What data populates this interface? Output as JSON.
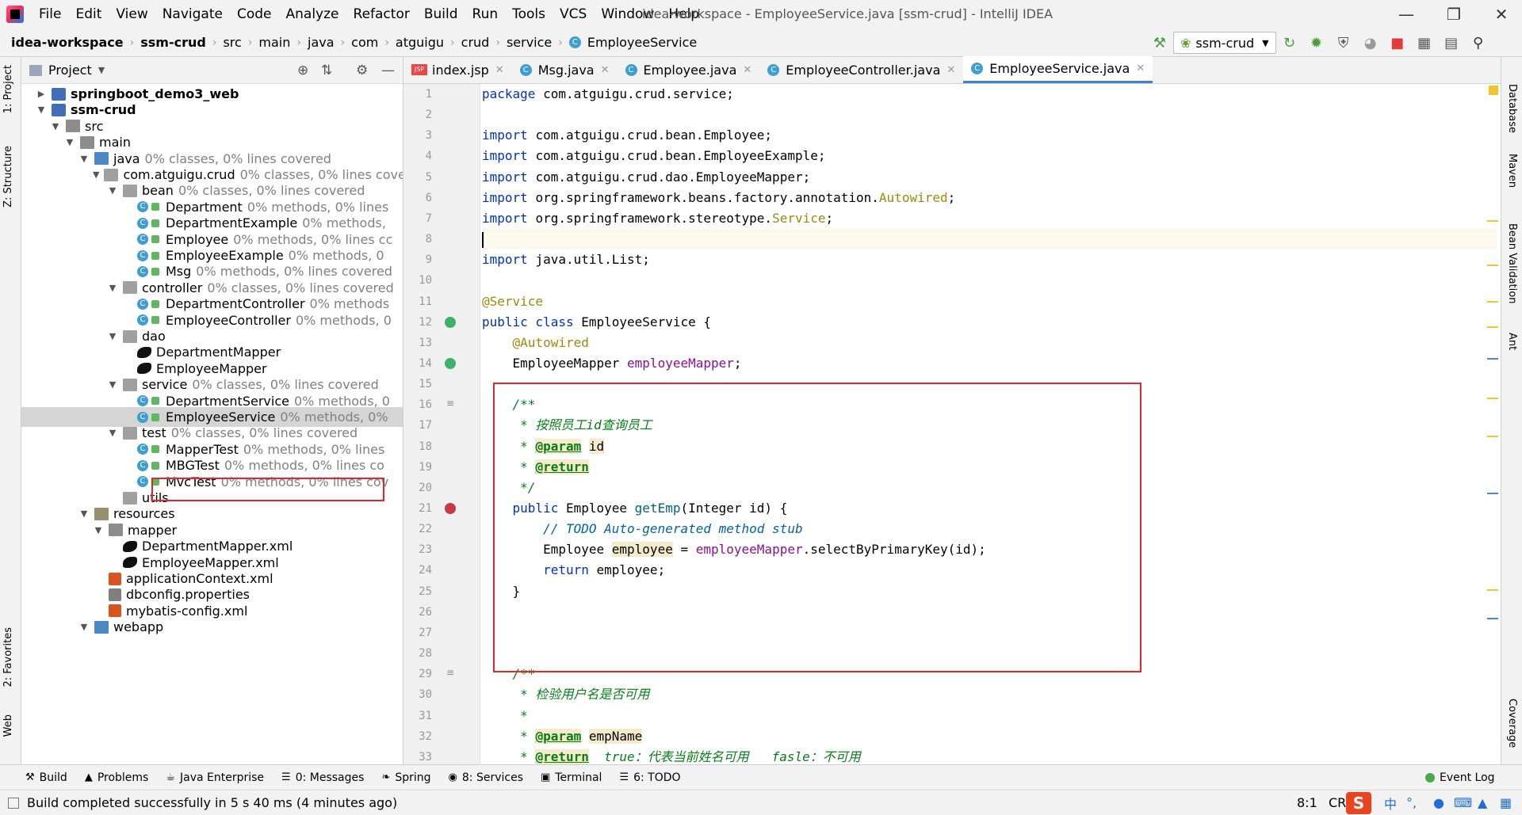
{
  "app": {
    "window_title": "idea-workspace - EmployeeService.java [ssm-crud] - IntelliJ IDEA",
    "menu": [
      "File",
      "Edit",
      "View",
      "Navigate",
      "Code",
      "Analyze",
      "Refactor",
      "Build",
      "Run",
      "Tools",
      "VCS",
      "Window",
      "Help"
    ]
  },
  "breadcrumb": [
    "idea-workspace",
    "ssm-crud",
    "src",
    "main",
    "java",
    "com",
    "atguigu",
    "crud",
    "service",
    "EmployeeService"
  ],
  "run_config": "ssm-crud",
  "side_tabs_left": [
    "1: Project",
    "Z: Structure",
    "2: Favorites",
    "Web"
  ],
  "side_tabs_right": [
    "Database",
    "Maven",
    "Bean Validation",
    "Ant",
    "Coverage"
  ],
  "project": {
    "title": "Project",
    "tree": [
      {
        "label": "springboot_demo3_web",
        "cov": "",
        "depth": 1,
        "arrow": "▶",
        "icon": "mod",
        "bold": true
      },
      {
        "label": "ssm-crud",
        "cov": "",
        "depth": 1,
        "arrow": "▼",
        "icon": "mod",
        "bold": true
      },
      {
        "label": "src",
        "cov": "",
        "depth": 2,
        "arrow": "▼",
        "icon": "folder"
      },
      {
        "label": "main",
        "cov": "",
        "depth": 3,
        "arrow": "▼",
        "icon": "folder"
      },
      {
        "label": "java",
        "cov": "0% classes, 0% lines covered",
        "depth": 4,
        "arrow": "▼",
        "icon": "src"
      },
      {
        "label": "com.atguigu.crud",
        "cov": "0% classes, 0% lines cover",
        "depth": 5,
        "arrow": "▼",
        "icon": "pkg"
      },
      {
        "label": "bean",
        "cov": "0% classes, 0% lines covered",
        "depth": 6,
        "arrow": "▼",
        "icon": "pkg"
      },
      {
        "label": "Department",
        "cov": "0% methods, 0% lines",
        "depth": 7,
        "arrow": "",
        "icon": "cls"
      },
      {
        "label": "DepartmentExample",
        "cov": "0% methods,",
        "depth": 7,
        "arrow": "",
        "icon": "cls"
      },
      {
        "label": "Employee",
        "cov": "0% methods, 0% lines cc",
        "depth": 7,
        "arrow": "",
        "icon": "cls"
      },
      {
        "label": "EmployeeExample",
        "cov": "0% methods, 0",
        "depth": 7,
        "arrow": "",
        "icon": "cls"
      },
      {
        "label": "Msg",
        "cov": "0% methods, 0% lines covered",
        "depth": 7,
        "arrow": "",
        "icon": "cls"
      },
      {
        "label": "controller",
        "cov": "0% classes, 0% lines covered",
        "depth": 6,
        "arrow": "▼",
        "icon": "pkg"
      },
      {
        "label": "DepartmentController",
        "cov": "0% methods",
        "depth": 7,
        "arrow": "",
        "icon": "cls"
      },
      {
        "label": "EmployeeController",
        "cov": "0% methods, 0",
        "depth": 7,
        "arrow": "",
        "icon": "cls"
      },
      {
        "label": "dao",
        "cov": "",
        "depth": 6,
        "arrow": "▼",
        "icon": "pkg"
      },
      {
        "label": "DepartmentMapper",
        "cov": "",
        "depth": 7,
        "arrow": "",
        "icon": "bird"
      },
      {
        "label": "EmployeeMapper",
        "cov": "",
        "depth": 7,
        "arrow": "",
        "icon": "bird"
      },
      {
        "label": "service",
        "cov": "0% classes, 0% lines covered",
        "depth": 6,
        "arrow": "▼",
        "icon": "pkg"
      },
      {
        "label": "DepartmentService",
        "cov": "0% methods, 0",
        "depth": 7,
        "arrow": "",
        "icon": "cls"
      },
      {
        "label": "EmployeeService",
        "cov": "0% methods, 0%",
        "depth": 7,
        "arrow": "",
        "icon": "cls",
        "selected": true
      },
      {
        "label": "test",
        "cov": "0% classes, 0% lines covered",
        "depth": 6,
        "arrow": "▼",
        "icon": "pkg"
      },
      {
        "label": "MapperTest",
        "cov": "0% methods, 0% lines",
        "depth": 7,
        "arrow": "",
        "icon": "cls"
      },
      {
        "label": "MBGTest",
        "cov": "0% methods, 0% lines co",
        "depth": 7,
        "arrow": "",
        "icon": "cls"
      },
      {
        "label": "MvcTest",
        "cov": "0% methods, 0% lines cov",
        "depth": 7,
        "arrow": "",
        "icon": "cls"
      },
      {
        "label": "utils",
        "cov": "",
        "depth": 6,
        "arrow": "",
        "icon": "pkg"
      },
      {
        "label": "resources",
        "cov": "",
        "depth": 4,
        "arrow": "▼",
        "icon": "res"
      },
      {
        "label": "mapper",
        "cov": "",
        "depth": 5,
        "arrow": "▼",
        "icon": "folder"
      },
      {
        "label": "DepartmentMapper.xml",
        "cov": "",
        "depth": 6,
        "arrow": "",
        "icon": "bird"
      },
      {
        "label": "EmployeeMapper.xml",
        "cov": "",
        "depth": 6,
        "arrow": "",
        "icon": "bird"
      },
      {
        "label": "applicationContext.xml",
        "cov": "",
        "depth": 5,
        "arrow": "",
        "icon": "xml"
      },
      {
        "label": "dbconfig.properties",
        "cov": "",
        "depth": 5,
        "arrow": "",
        "icon": "props"
      },
      {
        "label": "mybatis-config.xml",
        "cov": "",
        "depth": 5,
        "arrow": "",
        "icon": "xml"
      },
      {
        "label": "webapp",
        "cov": "",
        "depth": 4,
        "arrow": "▼",
        "icon": "src"
      }
    ]
  },
  "editor": {
    "tabs": [
      {
        "label": "index.jsp",
        "kind": "jsp"
      },
      {
        "label": "Msg.java",
        "kind": "class"
      },
      {
        "label": "Employee.java",
        "kind": "class"
      },
      {
        "label": "EmployeeController.java",
        "kind": "class"
      },
      {
        "label": "EmployeeService.java",
        "kind": "class",
        "active": true
      }
    ],
    "lines": [
      [
        [
          "kw",
          "package "
        ],
        [
          "",
          "com.atguigu.crud.service;"
        ]
      ],
      [],
      [
        [
          "kw",
          "import "
        ],
        [
          "",
          "com.atguigu.crud.bean.Employee;"
        ]
      ],
      [
        [
          "kw",
          "import "
        ],
        [
          "",
          "com.atguigu.crud.bean.EmployeeExample;"
        ]
      ],
      [
        [
          "kw",
          "import "
        ],
        [
          "",
          "com.atguigu.crud.dao.EmployeeMapper;"
        ]
      ],
      [
        [
          "kw",
          "import "
        ],
        [
          "",
          "org.springframework.beans.factory.annotation."
        ],
        [
          "ann",
          "Autowired"
        ],
        [
          "",
          ";"
        ]
      ],
      [
        [
          "kw",
          "import "
        ],
        [
          "",
          "org.springframework.stereotype."
        ],
        [
          "ann",
          "Service"
        ],
        [
          "",
          ";"
        ]
      ],
      [],
      [
        [
          "kw",
          "import "
        ],
        [
          "",
          "java.util.List;"
        ]
      ],
      [],
      [
        [
          "ann",
          "@Service"
        ]
      ],
      [
        [
          "kw",
          "public class "
        ],
        [
          "",
          "EmployeeService {"
        ]
      ],
      [
        [
          "",
          "    "
        ],
        [
          "ann",
          "@Autowired"
        ]
      ],
      [
        [
          "",
          "    EmployeeMapper "
        ],
        [
          "fld",
          "employeeMapper"
        ],
        [
          "",
          ";"
        ]
      ],
      [],
      [
        [
          "doc",
          "    /**"
        ]
      ],
      [
        [
          "doc",
          "     * 按照员工id查询员工"
        ]
      ],
      [
        [
          "doc",
          "     * "
        ],
        [
          "tag",
          "@param"
        ],
        [
          "doc",
          " "
        ],
        [
          "hl",
          "id"
        ]
      ],
      [
        [
          "doc",
          "     * "
        ],
        [
          "tag",
          "@return"
        ]
      ],
      [
        [
          "doc",
          "     */"
        ]
      ],
      [
        [
          "kw",
          "    public "
        ],
        [
          "",
          "Employee "
        ],
        [
          "mth",
          "getEmp"
        ],
        [
          "",
          "(Integer id) {"
        ]
      ],
      [
        [
          "cmt",
          "        // TODO Auto-generated method stub"
        ]
      ],
      [
        [
          "",
          "        Employee "
        ],
        [
          "hl",
          "employee"
        ],
        [
          "",
          " = "
        ],
        [
          "fld",
          "employeeMapper"
        ],
        [
          "",
          ".selectByPrimaryKey(id);"
        ]
      ],
      [
        [
          "kw",
          "        return "
        ],
        [
          "",
          "employee;"
        ]
      ],
      [
        [
          "",
          "    }"
        ]
      ],
      [],
      [],
      [],
      [
        [
          "doc",
          "    /**"
        ]
      ],
      [
        [
          "doc",
          "     * 检验用户名是否可用"
        ]
      ],
      [
        [
          "doc",
          "     *"
        ]
      ],
      [
        [
          "doc",
          "     * "
        ],
        [
          "tag",
          "@param"
        ],
        [
          "doc",
          " "
        ],
        [
          "hl",
          "empName"
        ]
      ],
      [
        [
          "doc",
          "     * "
        ],
        [
          "tag",
          "@return"
        ],
        [
          "doc",
          "  true：代表当前姓名可用   fasle：不可用"
        ]
      ]
    ]
  },
  "bottom_tabs": [
    {
      "icon": "⚒",
      "label": "Build"
    },
    {
      "icon": "▲",
      "label": "Problems"
    },
    {
      "icon": "☕",
      "label": "Java Enterprise"
    },
    {
      "icon": "☰",
      "label": "0: Messages"
    },
    {
      "icon": "❧",
      "label": "Spring"
    },
    {
      "icon": "◉",
      "label": "8: Services"
    },
    {
      "icon": "▣",
      "label": "Terminal"
    },
    {
      "icon": "☰",
      "label": "6: TODO"
    }
  ],
  "event_log": "Event Log",
  "status": {
    "message": "Build completed successfully in 5 s 40 ms (4 minutes ago)",
    "position": "8:1",
    "line_sep": "CRL",
    "ime": "中"
  }
}
